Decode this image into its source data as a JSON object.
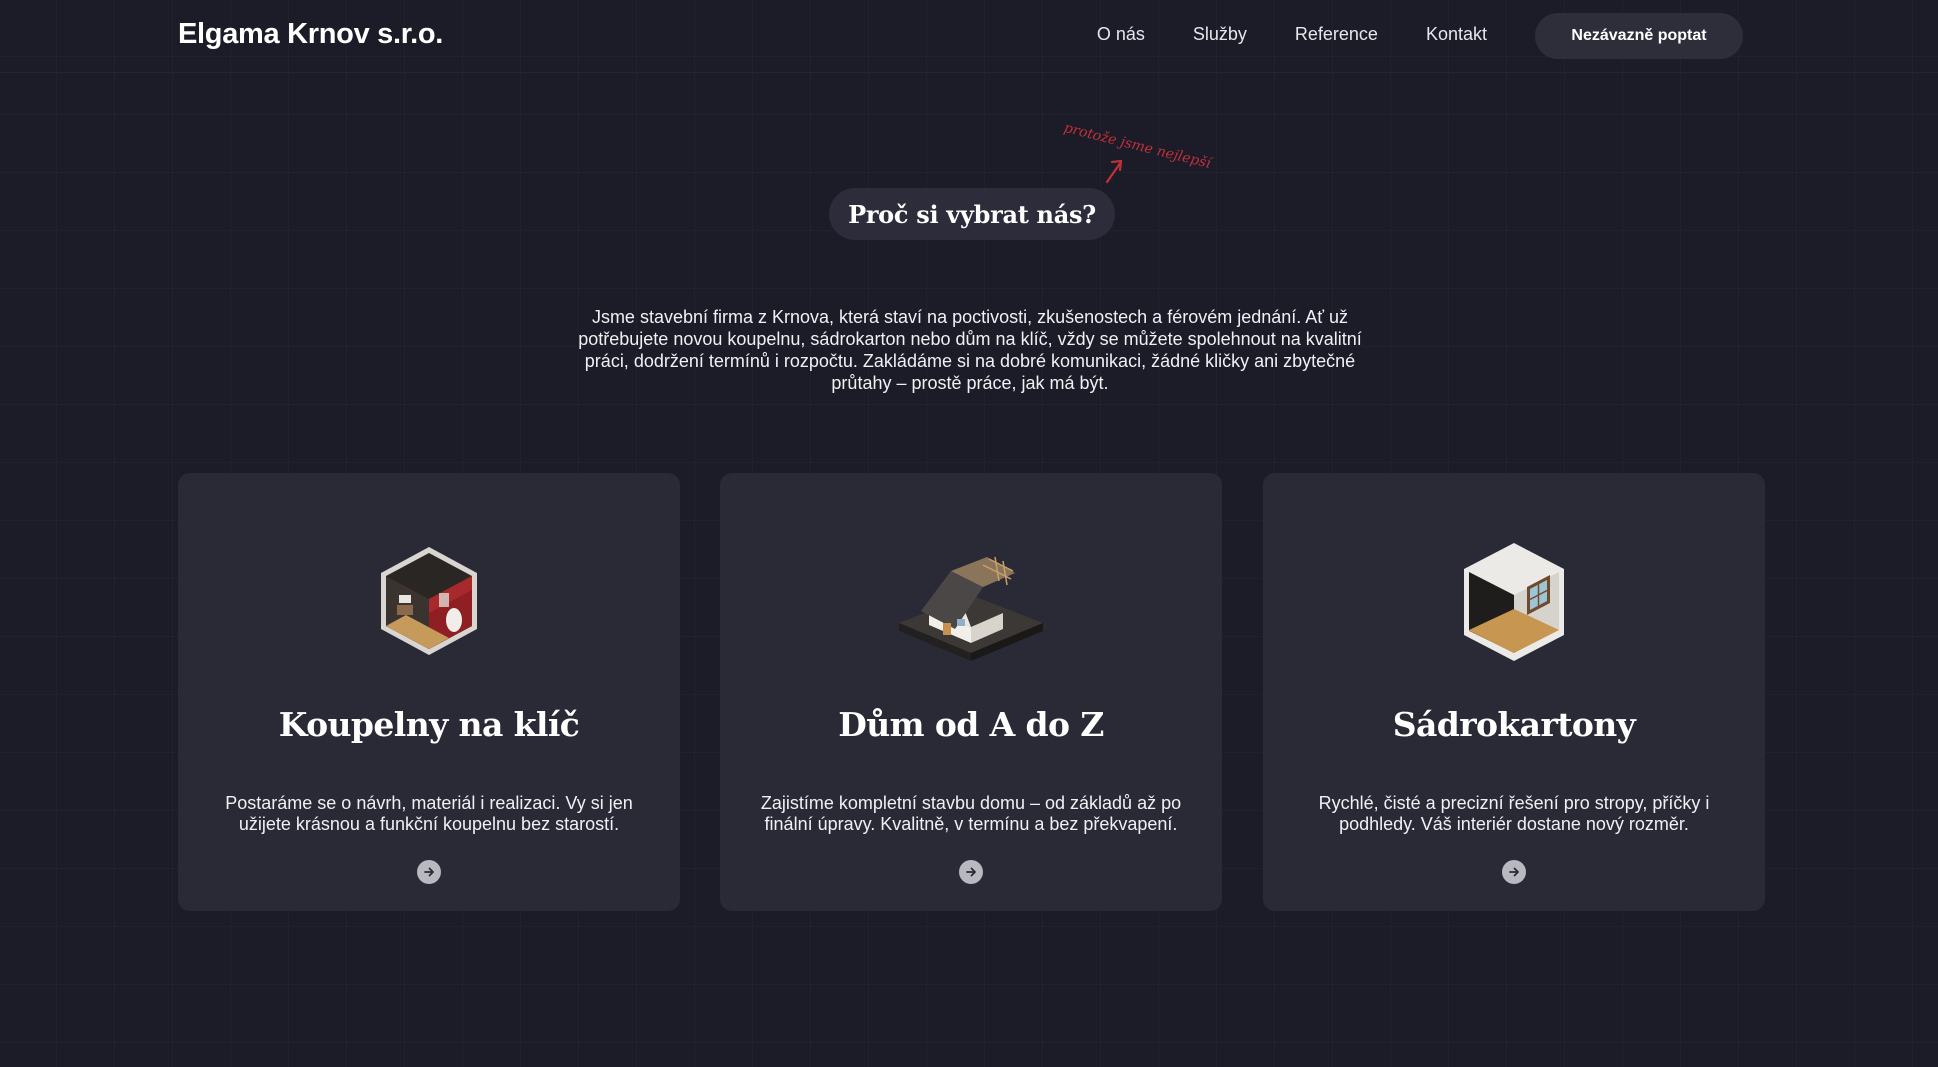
{
  "nav": {
    "logo": "Elgama Krnov s.r.o.",
    "links": [
      {
        "label": "O nás"
      },
      {
        "label": "Služby"
      },
      {
        "label": "Reference"
      },
      {
        "label": "Kontakt"
      }
    ],
    "cta_label": "Nezávazně poptat"
  },
  "hero": {
    "note": "protože jsme nejlepší",
    "title": "Proč si vybrat nás?",
    "intro": "Jsme stavební firma z Krnova, která staví na poctivosti, zkušenostech a férovém jednání. Ať už potřebujete novou koupelnu, sádrokarton nebo dům na klíč, vždy se můžete spolehnout na kvalitní práci, dodržení termínů i rozpočtu. Zakládáme si na dobré komunikaci, žádné kličky ani zbytečné průtahy – prostě práce, jak má být."
  },
  "cards": [
    {
      "title": "Koupelny na klíč",
      "text": "Postaráme se o návrh, materiál i realizaci. Vy si jen užijete krásnou a funkční koupelnu bez starostí.",
      "icon": "bathroom-isometric-icon"
    },
    {
      "title": "Dům od A do Z",
      "text": "Zajistíme kompletní stavbu domu – od základů až po finální úpravy. Kvalitně, v termínu a bez překvapení.",
      "icon": "house-isometric-icon"
    },
    {
      "title": "Sádrokartony",
      "text": "Rychlé, čisté a precizní řešení pro stropy, příčky i podhledy. Váš interiér dostane nový rozměr.",
      "icon": "room-isometric-icon"
    }
  ],
  "colors": {
    "background": "#1c1c28",
    "card": "#2a2a36",
    "pill": "#2c2c3a",
    "accent_note": "#c0303a"
  }
}
